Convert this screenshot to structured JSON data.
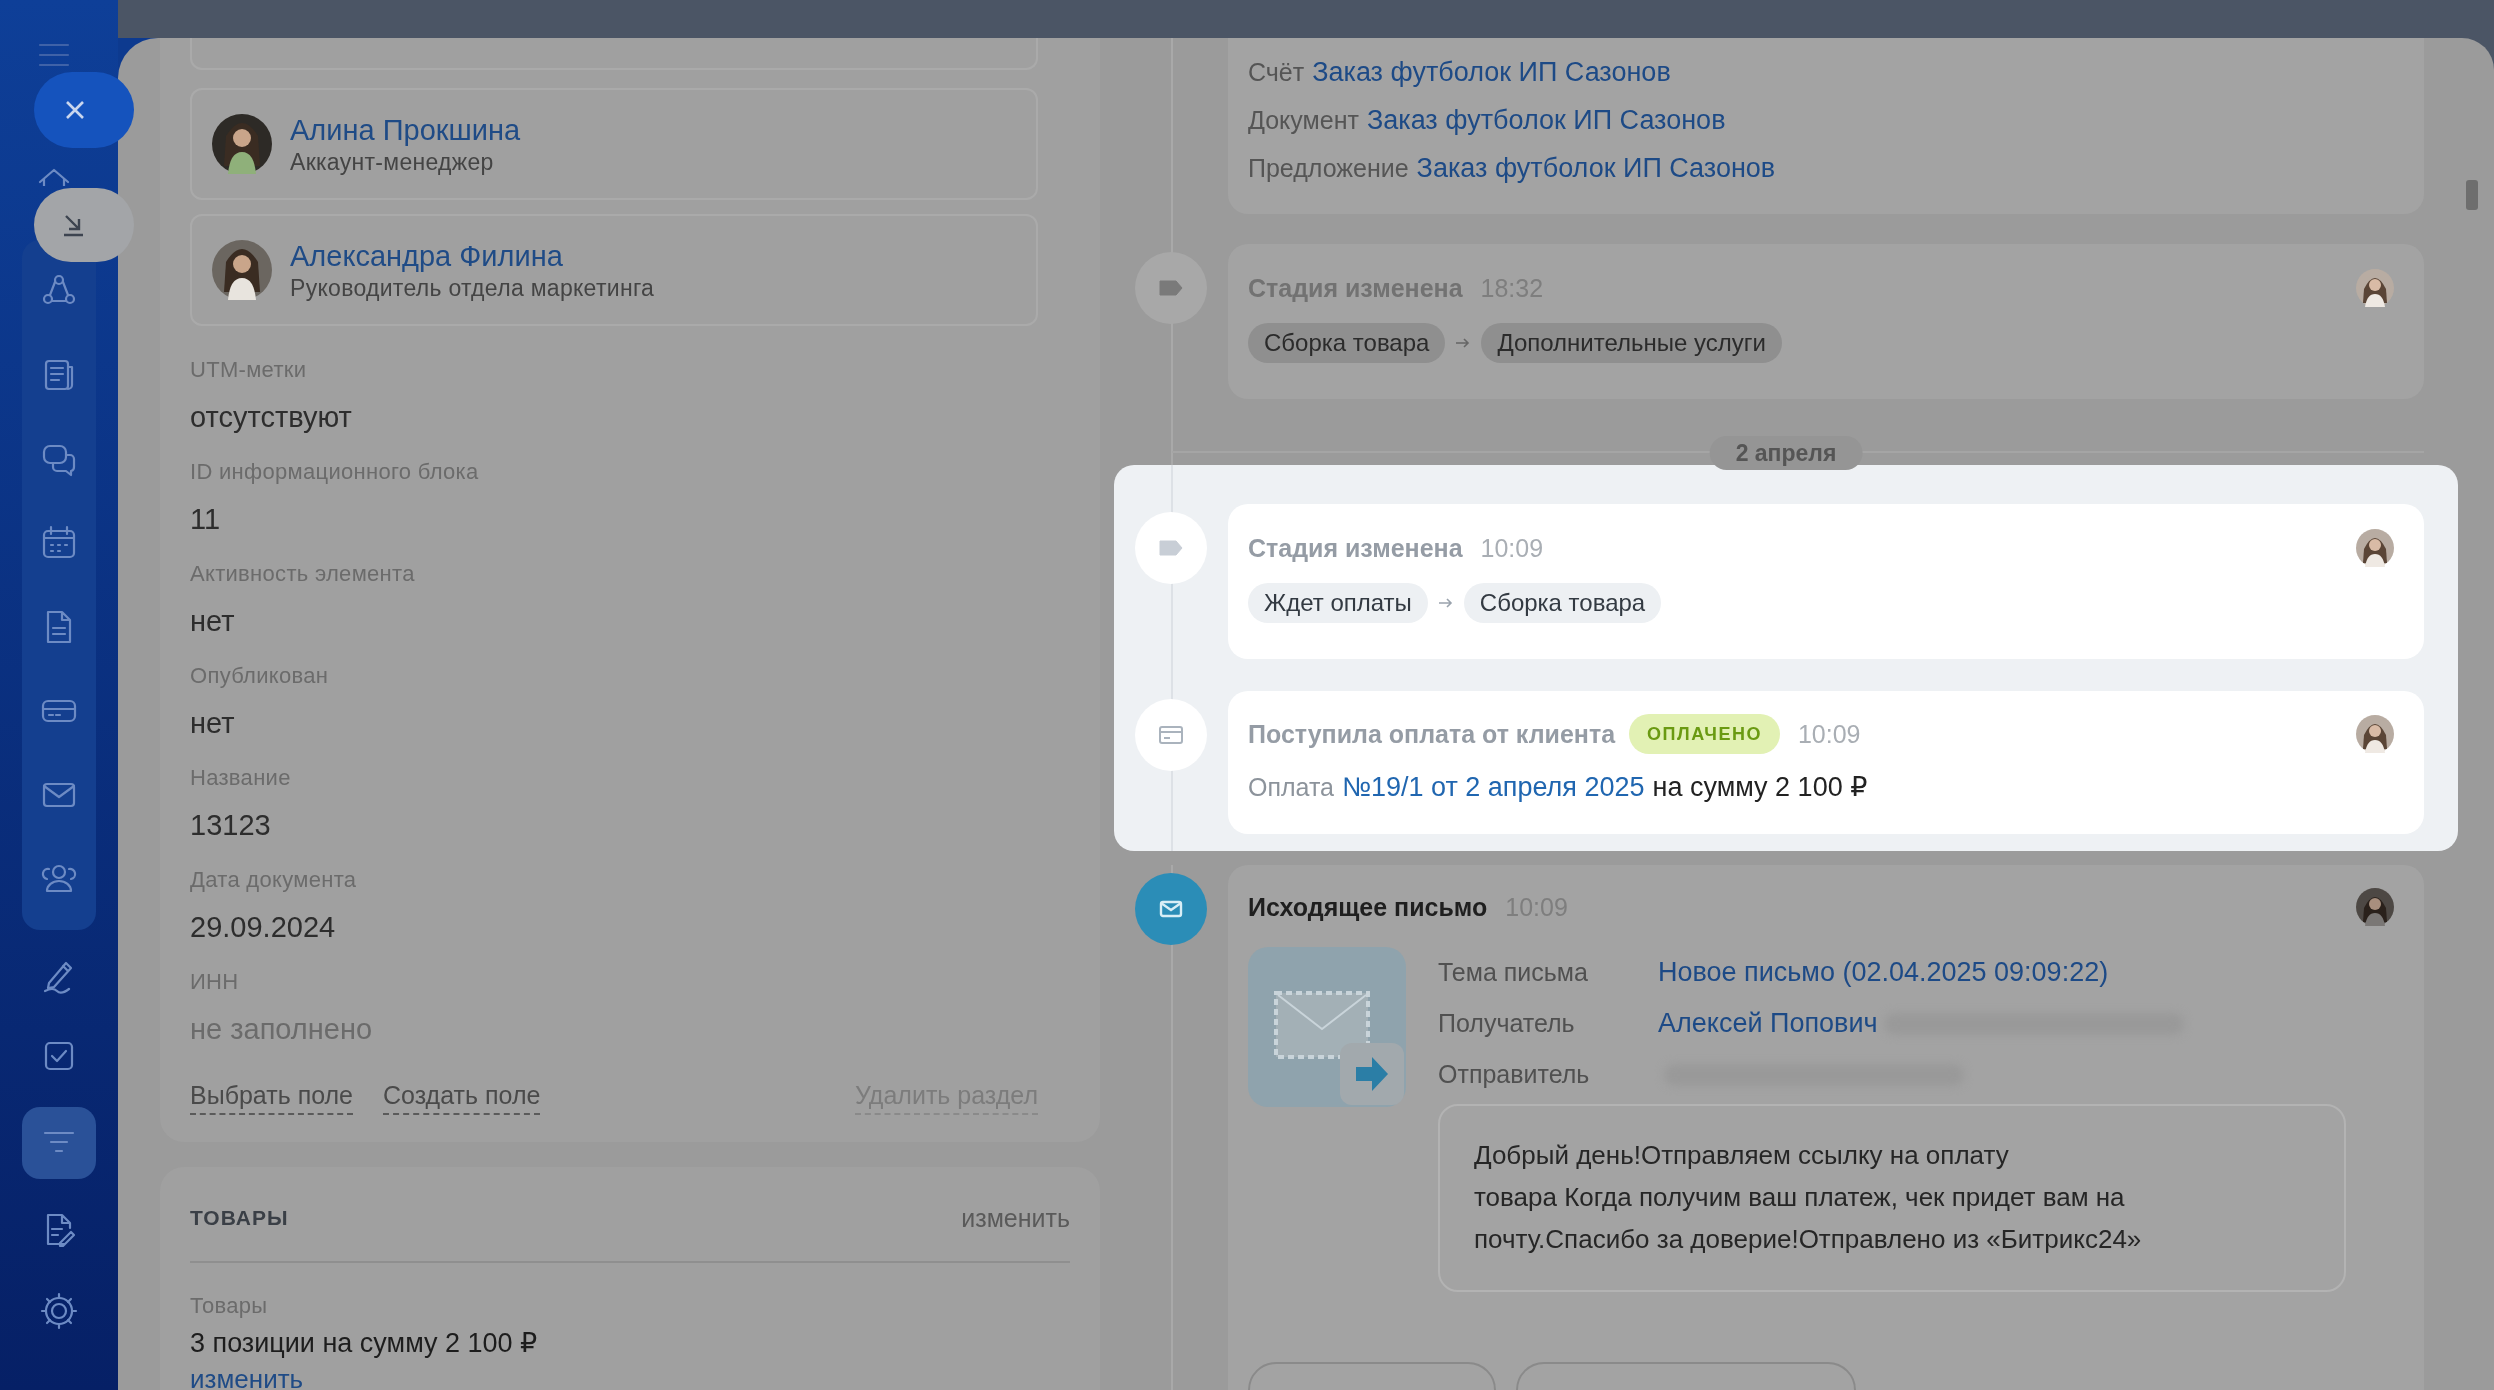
{
  "sidebar": {
    "group": [
      {
        "kind": "network",
        "selected": false
      },
      {
        "kind": "news",
        "selected": false
      },
      {
        "kind": "chats",
        "selected": false
      },
      {
        "kind": "calendar",
        "selected": false
      },
      {
        "kind": "document",
        "selected": false
      },
      {
        "kind": "terminal",
        "selected": false
      },
      {
        "kind": "mail",
        "selected": false
      },
      {
        "kind": "contacts",
        "selected": false
      }
    ],
    "items": [
      {
        "kind": "signature",
        "selected": false
      },
      {
        "kind": "tasks",
        "selected": false
      },
      {
        "kind": "funnel",
        "selected": true
      },
      {
        "kind": "edit-doc",
        "selected": false
      }
    ],
    "footer": [
      {
        "kind": "settings",
        "selected": false
      }
    ]
  },
  "contacts": [
    {
      "name": "Алина Прокшина",
      "role": "Аккаунт-менеджер"
    },
    {
      "name": "Александра Филина",
      "role": "Руководитель отдела маркетинга"
    }
  ],
  "fields": [
    {
      "label": "UTM-метки",
      "value": "отсутствуют",
      "empty": false
    },
    {
      "label": "ID информационного блока",
      "value": "11",
      "empty": false
    },
    {
      "label": "Активность элемента",
      "value": "нет",
      "empty": false
    },
    {
      "label": "Опубликован",
      "value": "нет",
      "empty": false
    },
    {
      "label": "Название",
      "value": "13123",
      "empty": false
    },
    {
      "label": "Дата документа",
      "value": "29.09.2024",
      "empty": false
    },
    {
      "label": "ИНН",
      "value": "не заполнено",
      "empty": true
    }
  ],
  "field_actions": {
    "select": "Выбрать поле",
    "create": "Создать поле",
    "delete": "Удалить раздел"
  },
  "products": {
    "title": "ТОВАРЫ",
    "edit": "изменить",
    "label": "Товары",
    "value": "3 позиции на сумму 2 100 ₽",
    "link": "изменить"
  },
  "timeline": [
    {
      "kind": "documents",
      "highlighted": false,
      "lines": [
        {
          "label": "Счёт",
          "link": "Заказ футболок ИП Сазонов"
        },
        {
          "label": "Документ",
          "link": "Заказ футболок ИП Сазонов"
        },
        {
          "label": "Предложение",
          "link": "Заказ футболок ИП Сазонов"
        }
      ]
    },
    {
      "kind": "stage",
      "highlighted": false,
      "title": "Стадия изменена",
      "time": "18:32",
      "from": "Сборка товара",
      "to": "Дополнительные услуги"
    },
    {
      "kind": "date",
      "highlighted": false,
      "label": "2 апреля"
    },
    {
      "kind": "stage",
      "highlighted": true,
      "title": "Стадия изменена",
      "time": "10:09",
      "from": "Ждет оплаты",
      "to": "Сборка товара"
    },
    {
      "kind": "payment",
      "highlighted": true,
      "title": "Поступила оплата от клиента",
      "badge": "ОПЛАЧЕНО",
      "time": "10:09",
      "prefix": "Оплата",
      "link": "№19/1 от 2 апреля 2025",
      "suffix": "на сумму 2 100 ₽"
    },
    {
      "kind": "email",
      "highlighted": false,
      "title": "Исходящее письмо",
      "time": "10:09",
      "fields": [
        {
          "label": "Тема письма",
          "value": "Новое письмо (02.04.2025 09:09:22)"
        },
        {
          "label": "Получатель",
          "value": "Алексей Попович",
          "redacted": true
        },
        {
          "label": "Отправитель",
          "redacted": true
        }
      ],
      "body": "Добрый день!Отправляем ссылку на оплату\nтовара Когда получим ваш платеж, чек придет вам на\nпочту.Спасибо за доверие!Отправлено из «Битрикс24»"
    }
  ]
}
